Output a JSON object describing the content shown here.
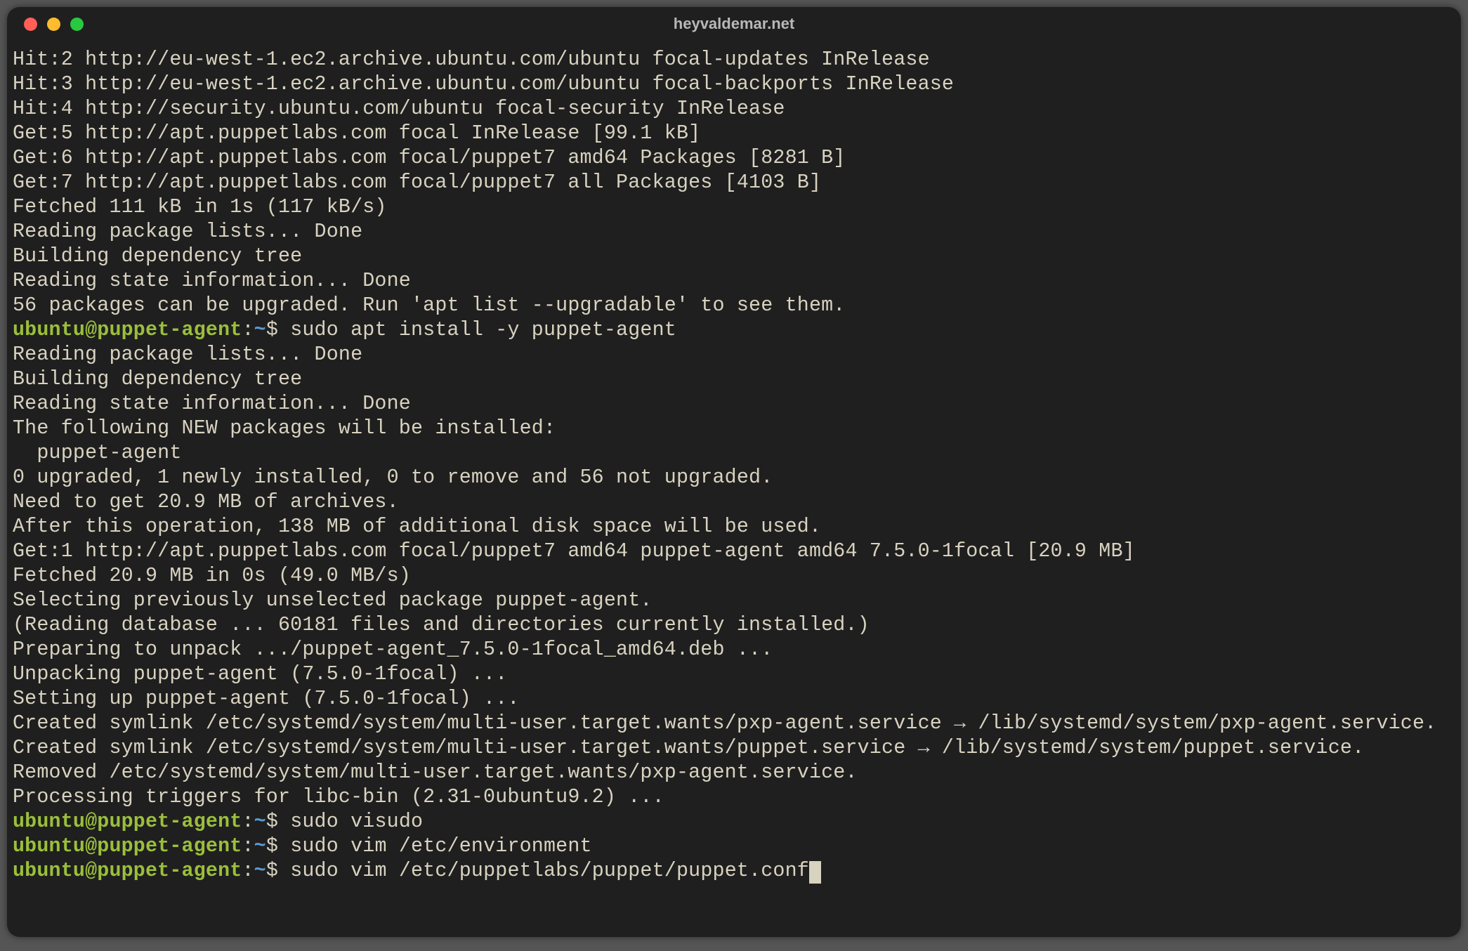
{
  "window": {
    "title": "heyvaldemar.net"
  },
  "colors": {
    "background": "#1f1f1f",
    "text": "#d8d2c0",
    "prompt_user": "#9bbf3b",
    "prompt_path": "#5a9bd4",
    "traffic_close": "#ff5f57",
    "traffic_min": "#febc2e",
    "traffic_zoom": "#28c840"
  },
  "prompt": {
    "user_host": "ubuntu@puppet-agent",
    "path": "~",
    "separator": ":",
    "symbol": "$"
  },
  "lines": [
    {
      "t": "out",
      "text": "Hit:2 http://eu-west-1.ec2.archive.ubuntu.com/ubuntu focal-updates InRelease"
    },
    {
      "t": "out",
      "text": "Hit:3 http://eu-west-1.ec2.archive.ubuntu.com/ubuntu focal-backports InRelease"
    },
    {
      "t": "out",
      "text": "Hit:4 http://security.ubuntu.com/ubuntu focal-security InRelease"
    },
    {
      "t": "out",
      "text": "Get:5 http://apt.puppetlabs.com focal InRelease [99.1 kB]"
    },
    {
      "t": "out",
      "text": "Get:6 http://apt.puppetlabs.com focal/puppet7 amd64 Packages [8281 B]"
    },
    {
      "t": "out",
      "text": "Get:7 http://apt.puppetlabs.com focal/puppet7 all Packages [4103 B]"
    },
    {
      "t": "out",
      "text": "Fetched 111 kB in 1s (117 kB/s)"
    },
    {
      "t": "out",
      "text": "Reading package lists... Done"
    },
    {
      "t": "out",
      "text": "Building dependency tree"
    },
    {
      "t": "out",
      "text": "Reading state information... Done"
    },
    {
      "t": "out",
      "text": "56 packages can be upgraded. Run 'apt list --upgradable' to see them."
    },
    {
      "t": "cmd",
      "text": "sudo apt install -y puppet-agent"
    },
    {
      "t": "out",
      "text": "Reading package lists... Done"
    },
    {
      "t": "out",
      "text": "Building dependency tree"
    },
    {
      "t": "out",
      "text": "Reading state information... Done"
    },
    {
      "t": "out",
      "text": "The following NEW packages will be installed:"
    },
    {
      "t": "out",
      "text": "  puppet-agent"
    },
    {
      "t": "out",
      "text": "0 upgraded, 1 newly installed, 0 to remove and 56 not upgraded."
    },
    {
      "t": "out",
      "text": "Need to get 20.9 MB of archives."
    },
    {
      "t": "out",
      "text": "After this operation, 138 MB of additional disk space will be used."
    },
    {
      "t": "out",
      "text": "Get:1 http://apt.puppetlabs.com focal/puppet7 amd64 puppet-agent amd64 7.5.0-1focal [20.9 MB]"
    },
    {
      "t": "out",
      "text": "Fetched 20.9 MB in 0s (49.0 MB/s)"
    },
    {
      "t": "out",
      "text": "Selecting previously unselected package puppet-agent."
    },
    {
      "t": "out",
      "text": "(Reading database ... 60181 files and directories currently installed.)"
    },
    {
      "t": "out",
      "text": "Preparing to unpack .../puppet-agent_7.5.0-1focal_amd64.deb ..."
    },
    {
      "t": "out",
      "text": "Unpacking puppet-agent (7.5.0-1focal) ..."
    },
    {
      "t": "out",
      "text": "Setting up puppet-agent (7.5.0-1focal) ..."
    },
    {
      "t": "out",
      "text": "Created symlink /etc/systemd/system/multi-user.target.wants/pxp-agent.service → /lib/systemd/system/pxp-agent.service."
    },
    {
      "t": "out",
      "text": "Created symlink /etc/systemd/system/multi-user.target.wants/puppet.service → /lib/systemd/system/puppet.service."
    },
    {
      "t": "out",
      "text": "Removed /etc/systemd/system/multi-user.target.wants/pxp-agent.service."
    },
    {
      "t": "out",
      "text": "Processing triggers for libc-bin (2.31-0ubuntu9.2) ..."
    },
    {
      "t": "cmd",
      "text": "sudo visudo"
    },
    {
      "t": "cmd",
      "text": "sudo vim /etc/environment"
    },
    {
      "t": "cmd",
      "text": "sudo vim /etc/puppetlabs/puppet/puppet.conf",
      "cursor": true
    }
  ]
}
